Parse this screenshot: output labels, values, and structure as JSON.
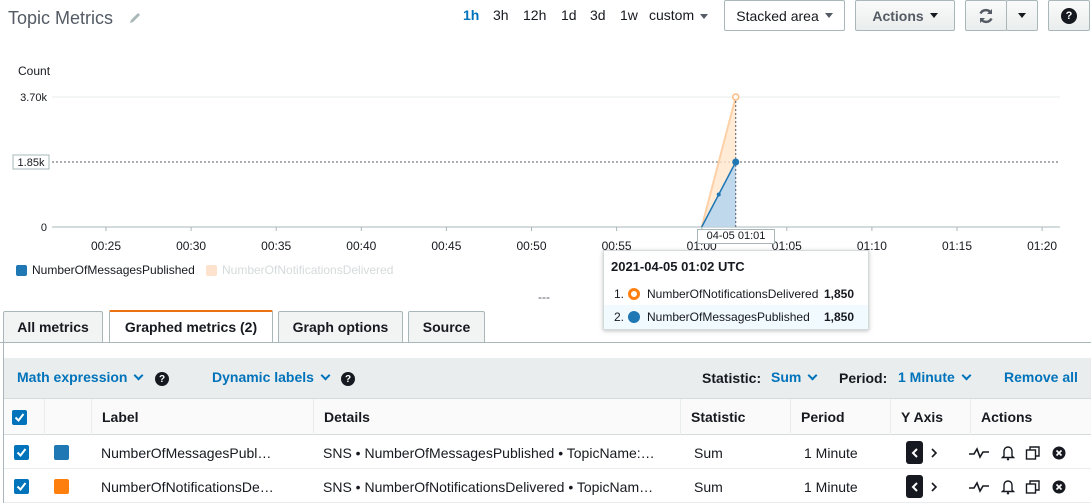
{
  "header": {
    "title": "Topic Metrics",
    "ranges": [
      "1h",
      "3h",
      "12h",
      "1d",
      "3d",
      "1w"
    ],
    "active_range": "1h",
    "custom_label": "custom",
    "chart_type_label": "Stacked area",
    "actions_label": "Actions"
  },
  "chart_data": {
    "type": "area",
    "ylabel": "Count",
    "yticks": [
      "0",
      "1.85k",
      "3.70k"
    ],
    "xticks": [
      "00:25",
      "00:30",
      "00:35",
      "00:40",
      "00:45",
      "00:50",
      "00:55",
      "01:00",
      "01:05",
      "01:10",
      "01:15",
      "01:20"
    ],
    "stacked": true,
    "ylim": [
      0,
      3700
    ],
    "series": [
      {
        "name": "NumberOfMessagesPublished",
        "color": "#1f77b4",
        "x": [
          "01:00",
          "01:01",
          "01:02"
        ],
        "values": [
          0,
          925,
          1850
        ]
      },
      {
        "name": "NumberOfNotificationsDelivered",
        "color": "#ff7f0e",
        "x": [
          "01:00",
          "01:01",
          "01:02"
        ],
        "values": [
          0,
          925,
          1850
        ]
      }
    ],
    "crosshair_label": "04-05 01:01",
    "hover_y_label": "1.85k"
  },
  "legend": {
    "items": [
      {
        "label": "NumberOfMessagesPublished",
        "color": "#1f77b4",
        "active": true
      },
      {
        "label": "NumberOfNotificationsDelivered",
        "color": "#fde3cd",
        "active": false
      }
    ]
  },
  "tooltip": {
    "title": "2021-04-05 01:02 UTC",
    "rows": [
      {
        "n": "1.",
        "name": "NumberOfNotificationsDelivered",
        "value": "1,850",
        "color": "#ff7f0e"
      },
      {
        "n": "2.",
        "name": "NumberOfMessagesPublished",
        "value": "1,850",
        "color": "#1f77b4"
      }
    ]
  },
  "splitter": "---",
  "tabs": {
    "items": [
      "All metrics",
      "Graphed metrics (2)",
      "Graph options",
      "Source"
    ],
    "active": "Graphed metrics (2)"
  },
  "toolbar": {
    "math_expression": "Math expression",
    "dynamic_labels": "Dynamic labels",
    "statistic_label": "Statistic:",
    "statistic_value": "Sum",
    "period_label": "Period:",
    "period_value": "1 Minute",
    "remove_all": "Remove all"
  },
  "table": {
    "headers": {
      "label": "Label",
      "details": "Details",
      "statistic": "Statistic",
      "period": "Period",
      "yaxis": "Y Axis",
      "actions": "Actions"
    },
    "rows": [
      {
        "color": "#1f77b4",
        "label": "NumberOfMessagesPubl…",
        "details": "SNS • NumberOfMessagesPublished • TopicName:…",
        "statistic": "Sum",
        "period": "1 Minute"
      },
      {
        "color": "#ff7f0e",
        "label": "NumberOfNotificationsDe…",
        "details": "SNS • NumberOfNotificationsDelivered • TopicNam…",
        "statistic": "Sum",
        "period": "1 Minute"
      }
    ]
  }
}
